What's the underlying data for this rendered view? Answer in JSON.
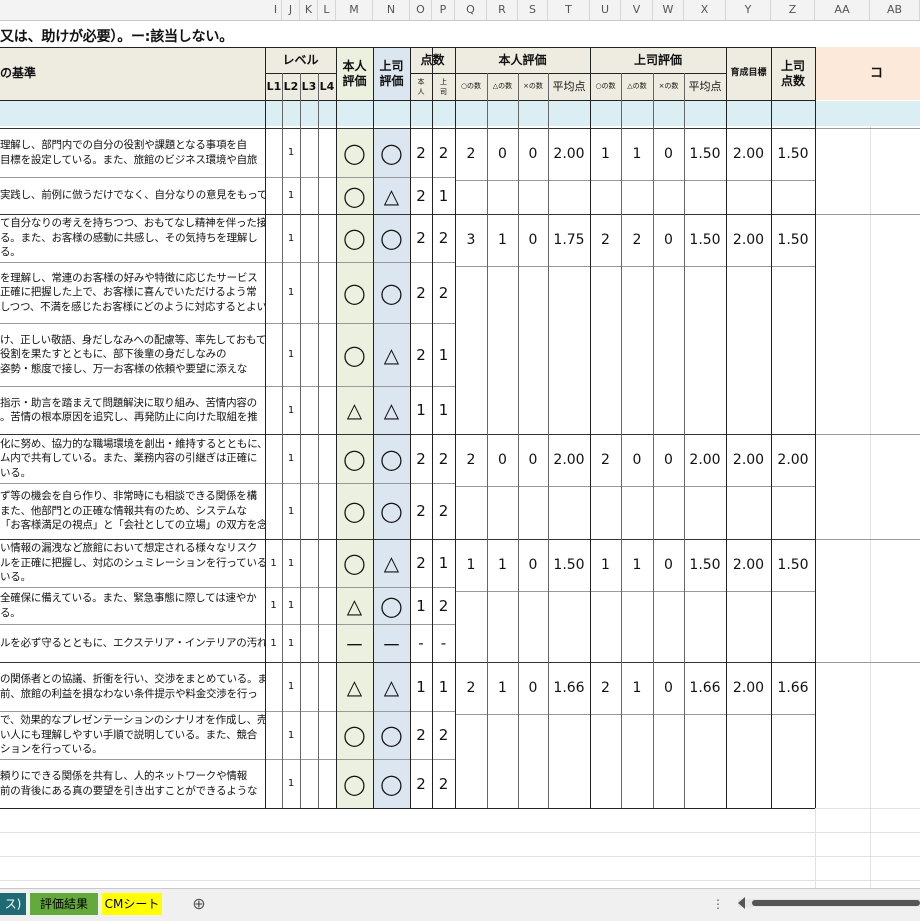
{
  "columns": [
    {
      "id": "col-i",
      "label": "I"
    },
    {
      "id": "col-j",
      "label": "J"
    },
    {
      "id": "col-k",
      "label": "K"
    },
    {
      "id": "col-l",
      "label": "L"
    },
    {
      "id": "col-m",
      "label": "M"
    },
    {
      "id": "col-n",
      "label": "N"
    },
    {
      "id": "col-o",
      "label": "O"
    },
    {
      "id": "col-p",
      "label": "P"
    },
    {
      "id": "col-q",
      "label": "Q"
    },
    {
      "id": "col-r",
      "label": "R"
    },
    {
      "id": "col-s",
      "label": "S"
    },
    {
      "id": "col-t",
      "label": "T"
    },
    {
      "id": "col-u",
      "label": "U"
    },
    {
      "id": "col-v",
      "label": "V"
    },
    {
      "id": "col-w",
      "label": "W"
    },
    {
      "id": "col-x",
      "label": "X"
    },
    {
      "id": "col-y",
      "label": "Y"
    },
    {
      "id": "col-z",
      "label": "Z"
    },
    {
      "id": "col-aa",
      "label": "AA"
    },
    {
      "id": "col-ab",
      "label": "AB"
    }
  ],
  "title_text": "又は、助けが必要）。ー:該当しない。",
  "header": {
    "criteria": "の基準",
    "level": "レベル",
    "levels": [
      "L1",
      "L2",
      "L3",
      "L4"
    ],
    "self_eval": "本人\n評価",
    "boss_eval": "上司\n評価",
    "points": "点数",
    "points_self": "本\n人",
    "points_boss": "上\n司",
    "self_group": "本人評価",
    "boss_group": "上司評価",
    "count_circle": "○の数",
    "count_triangle": "△の数",
    "count_cross": "×の数",
    "avg": "平均点",
    "target": "育成目標",
    "boss_score": "上司\n点数",
    "comment": "コ"
  },
  "rows": [
    {
      "text": [
        "理解し、部門内での自分の役割や課題となる事項を自",
        "目標を設定している。また、旅館のビジネス環境や自旅"
      ],
      "l1": "",
      "l2": "1",
      "self": "◯",
      "boss": "◯",
      "ps": "2",
      "pb": "2"
    },
    {
      "text": [
        "実践し、前例に倣うだけでなく、自分なりの意見をもって"
      ],
      "l1": "",
      "l2": "1",
      "self": "◯",
      "boss": "△",
      "ps": "2",
      "pb": "1"
    },
    {
      "text": [
        "て自分なりの考えを持ちつつ、おもてなし精神を伴った接",
        "る。また、お客様の感動に共感し、その気持ちを理解し",
        "る。"
      ],
      "l1": "",
      "l2": "1",
      "self": "◯",
      "boss": "◯",
      "ps": "2",
      "pb": "2"
    },
    {
      "text": [
        "を理解し、常連のお客様の好みや特徴に応じたサービス",
        "正確に把握した上で、お客様に喜んでいただけるよう常",
        "しつつ、不満を感じたお客様にどのように対応するとよい"
      ],
      "l1": "",
      "l2": "1",
      "self": "◯",
      "boss": "◯",
      "ps": "2",
      "pb": "2"
    },
    {
      "text": [
        "け、正しい敬語、身だしなみへの配慮等、率先しておもて",
        "役割を果たすとともに、部下後輩の身だしなみの",
        "姿勢・態度で接し、万一お客様の依頼や要望に添えな"
      ],
      "l1": "",
      "l2": "1",
      "self": "◯",
      "boss": "△",
      "ps": "2",
      "pb": "1"
    },
    {
      "text": [
        "指示・助言を踏まえて問題解決に取り組み、苦情内容の",
        "。苦情の根本原因を追究し、再発防止に向けた取組を推"
      ],
      "l1": "",
      "l2": "1",
      "self": "△",
      "boss": "△",
      "ps": "1",
      "pb": "1"
    },
    {
      "text": [
        "化に努め、協力的な職場環境を創出・維持するとともに、",
        "ム内で共有している。また、業務内容の引継ぎは正確に",
        "いる。"
      ],
      "l1": "",
      "l2": "1",
      "self": "◯",
      "boss": "◯",
      "ps": "2",
      "pb": "2"
    },
    {
      "text": [
        "ず等の機会を自ら作り、非常時にも相談できる関係を構",
        "また、他部門との正確な情報共有のため、システムな",
        "「お客様満足の視点」と「会社としての立場」の双方を念"
      ],
      "l1": "",
      "l2": "1",
      "self": "◯",
      "boss": "◯",
      "ps": "2",
      "pb": "2"
    },
    {
      "text": [
        "い情報の漏洩など旅館において想定される様々なリスク",
        "ルを正確に把握し、対応のシュミレーションを行っている",
        "いる。"
      ],
      "l1": "1",
      "l2": "1",
      "self": "◯",
      "boss": "△",
      "ps": "2",
      "pb": "1"
    },
    {
      "text": [
        "全確保に備えている。また、緊急事態に際しては速やか",
        "る。"
      ],
      "l1": "1",
      "l2": "1",
      "self": "△",
      "boss": "◯",
      "ps": "1",
      "pb": "2"
    },
    {
      "text": [
        "ルを必ず守るとともに、エクステリア・インテリアの汚れ"
      ],
      "l1": "1",
      "l2": "1",
      "self": "－",
      "boss": "－",
      "ps": "-",
      "pb": "-"
    },
    {
      "text": [
        "の関係者との協議、折衝を行い、交渉をまとめている。ま",
        "前、旅館の利益を損なわない条件提示や料金交渉を行っ"
      ],
      "l1": "",
      "l2": "1",
      "self": "△",
      "boss": "△",
      "ps": "1",
      "pb": "1"
    },
    {
      "text": [
        "で、効果的なプレゼンテーションのシナリオを作成し、売",
        "い人にも理解しやすい手順で説明している。また、競合",
        "ションを行っている。"
      ],
      "l1": "",
      "l2": "1",
      "self": "◯",
      "boss": "◯",
      "ps": "2",
      "pb": "2"
    },
    {
      "text": [
        "頼りにできる関係を共有し、人的ネットワークや情報",
        "前の背後にある真の要望を引き出すことができるような"
      ],
      "l1": "",
      "l2": "1",
      "self": "◯",
      "boss": "◯",
      "ps": "2",
      "pb": "2"
    }
  ],
  "groups": [
    {
      "sc": "2",
      "st": "0",
      "sx": "0",
      "savg": "2.00",
      "bc": "1",
      "bt": "1",
      "bx": "0",
      "bavg": "1.50",
      "target": "2.00",
      "bscore": "1.50"
    },
    {
      "sc": "3",
      "st": "1",
      "sx": "0",
      "savg": "1.75",
      "bc": "2",
      "bt": "2",
      "bx": "0",
      "bavg": "1.50",
      "target": "2.00",
      "bscore": "1.50"
    },
    {
      "sc": "2",
      "st": "0",
      "sx": "0",
      "savg": "2.00",
      "bc": "2",
      "bt": "0",
      "bx": "0",
      "bavg": "2.00",
      "target": "2.00",
      "bscore": "2.00"
    },
    {
      "sc": "1",
      "st": "1",
      "sx": "0",
      "savg": "1.50",
      "bc": "1",
      "bt": "1",
      "bx": "0",
      "bavg": "1.50",
      "target": "2.00",
      "bscore": "1.50"
    },
    {
      "sc": "2",
      "st": "1",
      "sx": "0",
      "savg": "1.66",
      "bc": "2",
      "bt": "1",
      "bx": "0",
      "bavg": "1.66",
      "target": "2.00",
      "bscore": "1.66"
    }
  ],
  "tabs": [
    {
      "label": "ス)",
      "color": "#1f6b75",
      "text": "#ffffff"
    },
    {
      "label": "評価結果",
      "color": "#63a93c",
      "text": "#000000"
    },
    {
      "label": "CMシート",
      "color": "#ffff00",
      "text": "#000000"
    }
  ],
  "add_sheet": "⊕",
  "more": "⋮",
  "colors": {
    "header_bg": "#eeece1",
    "self_bg": "#ebf1de",
    "boss_bg": "#dce6f1",
    "section_bg": "#dbeef4",
    "comment_bg": "#fde9d9"
  }
}
